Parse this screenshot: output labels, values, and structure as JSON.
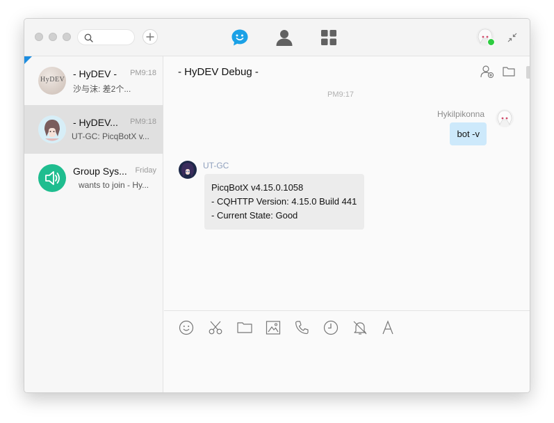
{
  "titlebar": {
    "search": {
      "placeholder": "",
      "value": ""
    }
  },
  "conversations": [
    {
      "title": "- HyDEV -",
      "time": "PM9:18",
      "preview": "沙与沫: 差2个...",
      "avatar_text": "HyDEV",
      "active": false
    },
    {
      "title": "- HyDEV...",
      "time": "PM9:18",
      "preview": "UT-GC: PicqBotX v...",
      "active": true
    },
    {
      "title": "Group Sys...",
      "time": "Friday",
      "preview": "wants to join - Hy...",
      "active": false
    }
  ],
  "chat": {
    "title": "- HyDEV Debug -",
    "time_separator": "PM9:17",
    "messages": [
      {
        "direction": "out",
        "sender": "Hykilpikonna",
        "text": "bot -v"
      },
      {
        "direction": "in",
        "sender": "UT-GC",
        "lines": [
          "PicqBotX v4.15.0.1058",
          "- CQHTTP Version: 4.15.0 Build 441",
          "- Current State: Good"
        ]
      }
    ]
  },
  "colors": {
    "accent": "#1ba1e6",
    "online": "#2ecc40",
    "outgoing_bubble": "#cde9fb",
    "incoming_bubble": "#ececec",
    "group_system": "#1fbd8f",
    "sender_in": "#8fa0bd"
  },
  "icons": {
    "nav": [
      "chat-icon",
      "contacts-icon",
      "apps-icon"
    ],
    "header": [
      "add-member-icon",
      "folder-icon"
    ],
    "toolbar": [
      "emoji-icon",
      "screenshot-icon",
      "folder-icon",
      "image-icon",
      "phone-icon",
      "history-icon",
      "mute-icon",
      "font-icon"
    ]
  }
}
